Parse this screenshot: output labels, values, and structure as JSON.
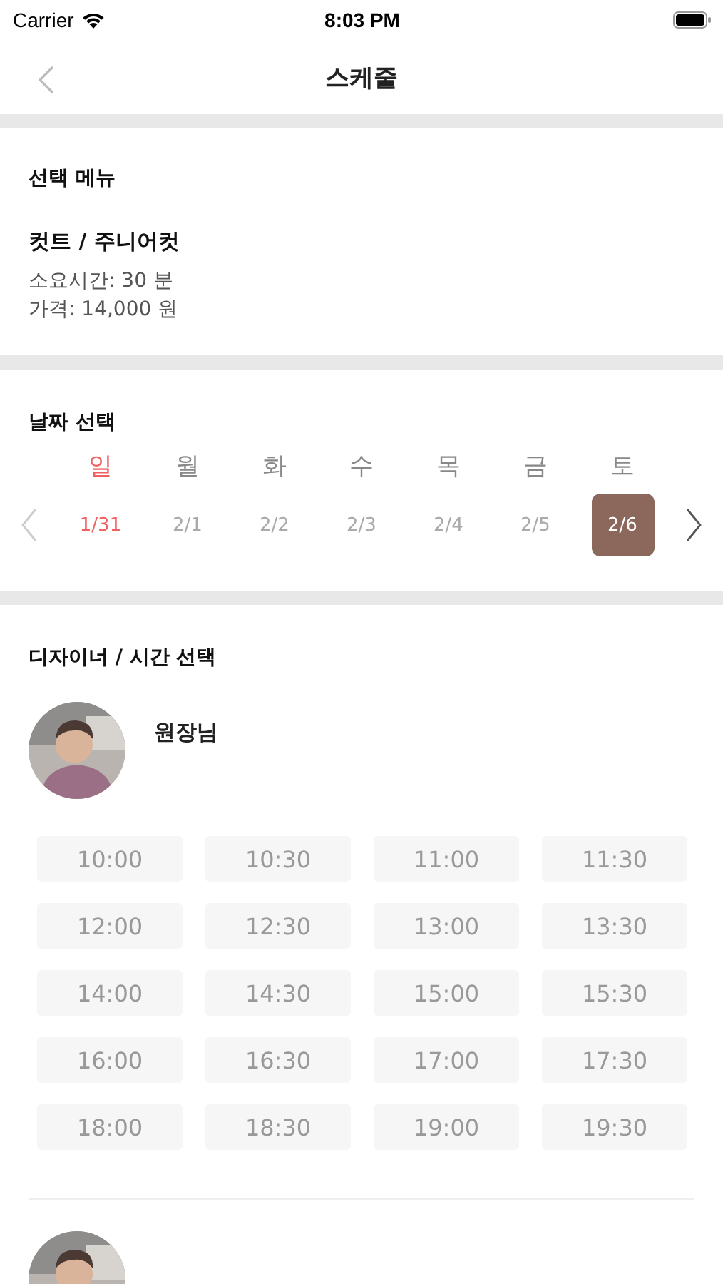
{
  "status_bar": {
    "carrier": "Carrier",
    "time": "8:03 PM"
  },
  "nav": {
    "title": "스케줄"
  },
  "menu_section": {
    "heading": "선택 메뉴",
    "item_name": "컷트 / 주니어컷",
    "duration": "소요시간: 30 분",
    "price": "가격: 14,000 원"
  },
  "date_section": {
    "heading": "날짜 선택",
    "days": [
      {
        "weekday": "일",
        "date": "1/31",
        "kind": "sunday",
        "selected": false
      },
      {
        "weekday": "월",
        "date": "2/1",
        "kind": "weekday",
        "selected": false
      },
      {
        "weekday": "화",
        "date": "2/2",
        "kind": "weekday",
        "selected": false
      },
      {
        "weekday": "수",
        "date": "2/3",
        "kind": "weekday",
        "selected": false
      },
      {
        "weekday": "목",
        "date": "2/4",
        "kind": "weekday",
        "selected": false
      },
      {
        "weekday": "금",
        "date": "2/5",
        "kind": "weekday",
        "selected": false
      },
      {
        "weekday": "토",
        "date": "2/6",
        "kind": "weekday",
        "selected": true
      }
    ]
  },
  "designer_section": {
    "heading": "디자이너 / 시간 선택",
    "designers": [
      {
        "avatar": {
          "kind": "picture"
        },
        "name": "원장님",
        "times": [
          {
            "label": "10:00",
            "selected": false
          },
          {
            "label": "10:30",
            "selected": false
          },
          {
            "label": "11:00",
            "selected": false
          },
          {
            "label": "11:30",
            "selected": false
          },
          {
            "label": "12:00",
            "selected": false
          },
          {
            "label": "12:30",
            "selected": false
          },
          {
            "label": "13:00",
            "selected": false
          },
          {
            "label": "13:30",
            "selected": false
          },
          {
            "label": "14:00",
            "selected": false
          },
          {
            "label": "14:30",
            "selected": false
          },
          {
            "label": "15:00",
            "selected": false
          },
          {
            "label": "15:30",
            "selected": false
          },
          {
            "label": "16:00",
            "selected": false
          },
          {
            "label": "16:30",
            "selected": false
          },
          {
            "label": "17:00",
            "selected": false
          },
          {
            "label": "17:30",
            "selected": false
          },
          {
            "label": "18:00",
            "selected": false
          },
          {
            "label": "18:30",
            "selected": false
          },
          {
            "label": "19:00",
            "selected": false
          },
          {
            "label": "19:30",
            "selected": false
          }
        ]
      },
      {
        "avatar": {
          "kind": "picture"
        }
      }
    ]
  }
}
